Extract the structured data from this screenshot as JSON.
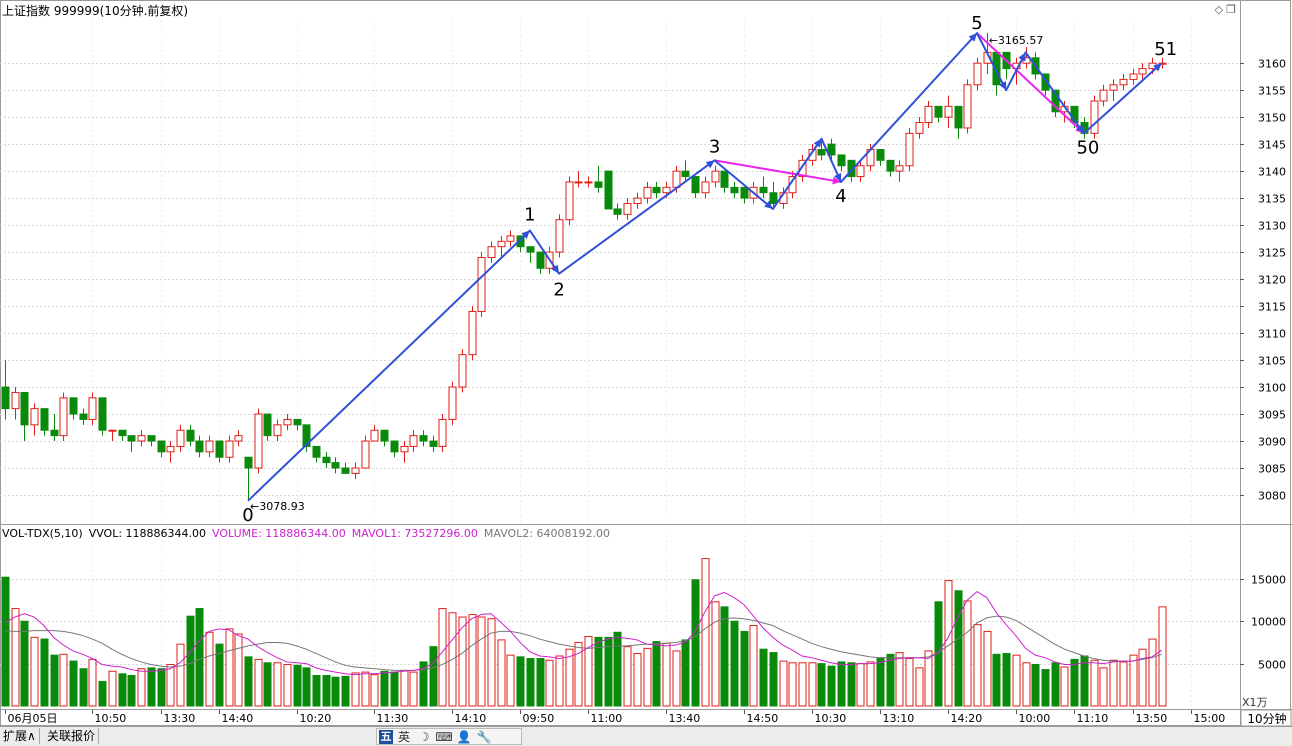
{
  "header": {
    "title": "上证指数 999999(10分钟.前复权)",
    "icons": [
      "diamond-icon",
      "restore-window-icon"
    ]
  },
  "colors": {
    "up": "#e0201a",
    "down": "#0a8a0a",
    "wave": "#3050d8",
    "wave_alt": "#ee22ee",
    "mavol1": "#cc22cc",
    "mavol2": "#777777",
    "grid": "#d8d8d8"
  },
  "chart_data": [
    {
      "type": "candlestick",
      "ylim": [
        3075,
        3168
      ],
      "yticks": [
        3080,
        3085,
        3090,
        3095,
        3100,
        3105,
        3110,
        3115,
        3120,
        3125,
        3130,
        3135,
        3140,
        3145,
        3150,
        3155,
        3160
      ],
      "grid": true,
      "candles": [
        [
          3100,
          3105,
          3094,
          3096
        ],
        [
          3096,
          3100,
          3094,
          3099
        ],
        [
          3099,
          3099,
          3090,
          3093
        ],
        [
          3093,
          3097,
          3091,
          3096
        ],
        [
          3096,
          3096,
          3091,
          3092
        ],
        [
          3092,
          3095,
          3090,
          3091
        ],
        [
          3091,
          3099,
          3090,
          3098
        ],
        [
          3098,
          3098,
          3094,
          3095
        ],
        [
          3095,
          3096,
          3093,
          3094
        ],
        [
          3094,
          3099,
          3093,
          3098
        ],
        [
          3098,
          3098,
          3091,
          3092
        ],
        [
          3092,
          3092,
          3090,
          3092
        ],
        [
          3092,
          3092,
          3090,
          3091
        ],
        [
          3091,
          3091,
          3088,
          3090
        ],
        [
          3090,
          3092,
          3089,
          3091
        ],
        [
          3091,
          3091,
          3089,
          3090
        ],
        [
          3090,
          3090,
          3087,
          3088
        ],
        [
          3088,
          3090,
          3086,
          3089
        ],
        [
          3089,
          3093,
          3088,
          3092
        ],
        [
          3092,
          3093,
          3089,
          3090
        ],
        [
          3090,
          3091,
          3087,
          3088
        ],
        [
          3088,
          3091,
          3087,
          3090
        ],
        [
          3090,
          3090,
          3086,
          3087
        ],
        [
          3087,
          3091,
          3086,
          3090
        ],
        [
          3090,
          3092,
          3089,
          3091
        ],
        [
          3087,
          3087,
          3078.93,
          3085
        ],
        [
          3085,
          3096,
          3084,
          3095
        ],
        [
          3095,
          3095,
          3090,
          3091
        ],
        [
          3091,
          3094,
          3090,
          3093
        ],
        [
          3093,
          3095,
          3092,
          3094
        ],
        [
          3094,
          3094,
          3092,
          3093
        ],
        [
          3093,
          3093,
          3088,
          3089
        ],
        [
          3089,
          3089,
          3086,
          3087
        ],
        [
          3087,
          3088,
          3085,
          3086
        ],
        [
          3086,
          3087,
          3084,
          3085
        ],
        [
          3085,
          3086,
          3084,
          3084
        ],
        [
          3084,
          3086,
          3083,
          3085
        ],
        [
          3085,
          3091,
          3085,
          3090
        ],
        [
          3090,
          3093,
          3090,
          3092
        ],
        [
          3092,
          3092,
          3089,
          3090
        ],
        [
          3090,
          3090,
          3087,
          3088
        ],
        [
          3088,
          3090,
          3086,
          3089
        ],
        [
          3089,
          3092,
          3088,
          3091
        ],
        [
          3091,
          3092,
          3089,
          3090
        ],
        [
          3090,
          3091,
          3088,
          3089
        ],
        [
          3089,
          3095,
          3088,
          3094
        ],
        [
          3094,
          3101,
          3093,
          3100
        ],
        [
          3100,
          3107,
          3099,
          3106
        ],
        [
          3106,
          3115,
          3105,
          3114
        ],
        [
          3114,
          3125,
          3113,
          3124
        ],
        [
          3124,
          3127,
          3123,
          3126
        ],
        [
          3126,
          3128,
          3124,
          3127
        ],
        [
          3127,
          3129,
          3126,
          3128
        ],
        [
          3128,
          3128,
          3125,
          3126
        ],
        [
          3126,
          3126,
          3123,
          3125
        ],
        [
          3125,
          3125,
          3121,
          3122
        ],
        [
          3122,
          3126,
          3121,
          3125
        ],
        [
          3125,
          3132,
          3124,
          3131
        ],
        [
          3131,
          3139,
          3130,
          3138
        ],
        [
          3138,
          3140,
          3137,
          3138
        ],
        [
          3138,
          3139,
          3137,
          3138
        ],
        [
          3138,
          3141,
          3136,
          3137
        ],
        [
          3140,
          3140,
          3133,
          3133
        ],
        [
          3133,
          3134,
          3131,
          3132
        ],
        [
          3132,
          3135,
          3131,
          3134
        ],
        [
          3134,
          3136,
          3133,
          3135
        ],
        [
          3135,
          3138,
          3134,
          3137
        ],
        [
          3137,
          3138,
          3135,
          3136
        ],
        [
          3136,
          3138,
          3135,
          3137
        ],
        [
          3137,
          3141,
          3136,
          3140
        ],
        [
          3140,
          3142,
          3138,
          3139
        ],
        [
          3139,
          3139,
          3135,
          3136
        ],
        [
          3136,
          3139,
          3135,
          3138
        ],
        [
          3138,
          3141,
          3137,
          3140
        ],
        [
          3140,
          3140,
          3136,
          3137
        ],
        [
          3137,
          3138,
          3135,
          3136
        ],
        [
          3137,
          3137,
          3134,
          3135
        ],
        [
          3135,
          3138,
          3134,
          3137
        ],
        [
          3137,
          3139,
          3135,
          3136
        ],
        [
          3136,
          3138,
          3133,
          3134
        ],
        [
          3134,
          3137,
          3133,
          3136
        ],
        [
          3136,
          3140,
          3135,
          3139
        ],
        [
          3139,
          3143,
          3138,
          3142
        ],
        [
          3142,
          3145,
          3141,
          3144
        ],
        [
          3144,
          3146,
          3142,
          3143
        ],
        [
          3145,
          3146,
          3142,
          3143
        ],
        [
          3143,
          3143,
          3140,
          3141
        ],
        [
          3142,
          3142,
          3138,
          3139
        ],
        [
          3139,
          3142,
          3138,
          3141
        ],
        [
          3141,
          3145,
          3140,
          3144
        ],
        [
          3144,
          3144,
          3141,
          3142
        ],
        [
          3142,
          3142,
          3139,
          3140
        ],
        [
          3140,
          3142,
          3138,
          3141
        ],
        [
          3141,
          3148,
          3140,
          3147
        ],
        [
          3147,
          3150,
          3146,
          3149
        ],
        [
          3149,
          3153,
          3148,
          3152
        ],
        [
          3152,
          3152,
          3149,
          3150
        ],
        [
          3150,
          3154,
          3148,
          3152
        ],
        [
          3152,
          3152,
          3146,
          3148
        ],
        [
          3148,
          3157,
          3147,
          3156
        ],
        [
          3156,
          3161,
          3155,
          3160
        ],
        [
          3160,
          3165.57,
          3158,
          3162
        ],
        [
          3162,
          3162,
          3154,
          3156
        ],
        [
          3162,
          3162,
          3157,
          3159
        ],
        [
          3159,
          3161,
          3156,
          3160
        ],
        [
          3160,
          3163,
          3159,
          3161
        ],
        [
          3161,
          3162,
          3157,
          3158
        ],
        [
          3158,
          3158,
          3154,
          3155
        ],
        [
          3155,
          3155,
          3150,
          3151
        ],
        [
          3151,
          3153,
          3149,
          3152
        ],
        [
          3152,
          3152,
          3148,
          3149
        ],
        [
          3149,
          3150,
          3146,
          3147
        ],
        [
          3147,
          3154,
          3146,
          3153
        ],
        [
          3153,
          3156,
          3152,
          3155
        ],
        [
          3155,
          3157,
          3153,
          3156
        ],
        [
          3156,
          3158,
          3155,
          3157
        ],
        [
          3157,
          3159,
          3156,
          3158
        ],
        [
          3158,
          3160,
          3157,
          3159
        ],
        [
          3159,
          3161,
          3158,
          3160
        ],
        [
          3160,
          3161,
          3159,
          3160
        ]
      ],
      "annotations": [
        {
          "text": "3078.93"
        },
        {
          "text": "3165.57"
        }
      ],
      "wave_labels": [
        "0",
        "1",
        "2",
        "3",
        "4",
        "5",
        "50",
        "51"
      ],
      "wave_main": [
        [
          25,
          3078.93
        ],
        [
          54,
          3129
        ],
        [
          57,
          3121
        ],
        [
          73,
          3142
        ],
        [
          79,
          3133
        ],
        [
          84,
          3146
        ],
        [
          86,
          3138
        ],
        [
          100,
          3165.57
        ],
        [
          103,
          3155
        ],
        [
          105,
          3162
        ],
        [
          111,
          3147
        ],
        [
          119,
          3160
        ]
      ],
      "wave_magenta": [
        [
          73,
          3142
        ],
        [
          86,
          3138
        ]
      ],
      "wave_magenta2": [
        [
          100,
          3165.57
        ],
        [
          111,
          3147
        ]
      ]
    },
    {
      "type": "bar",
      "title": "VOL-TDX(5,10)",
      "ylim": [
        0,
        19000
      ],
      "yticks": [
        5000,
        10000,
        15000
      ],
      "unit": "X1万",
      "legend": [
        {
          "label": "VVOL: 118886344.00",
          "color": "#000000"
        },
        {
          "label": "VOLUME: 118886344.00",
          "color": "#cc22cc"
        },
        {
          "label": "MAVOL1: 73527296.00",
          "color": "#cc22cc"
        },
        {
          "label": "MAVOL2: 64008192.00",
          "color": "#777777"
        }
      ],
      "volumes": [
        15200,
        11500,
        10000,
        8100,
        7900,
        6000,
        6100,
        5300,
        4400,
        5500,
        2900,
        4100,
        3800,
        3600,
        4400,
        4500,
        4400,
        4900,
        7300,
        10600,
        11500,
        8700,
        7300,
        9100,
        8500,
        5800,
        5500,
        5100,
        5100,
        4900,
        4800,
        4500,
        3600,
        3600,
        3400,
        3500,
        3900,
        4000,
        3700,
        4100,
        4000,
        4200,
        4000,
        5200,
        7000,
        11500,
        11000,
        10500,
        10800,
        10500,
        10300,
        7800,
        6000,
        5800,
        5600,
        5600,
        5400,
        5900,
        6700,
        7500,
        8200,
        8100,
        8100,
        8700,
        7000,
        6200,
        6800,
        7600,
        7400,
        6500,
        7800,
        14900,
        17400,
        12300,
        11700,
        10000,
        8800,
        9500,
        6700,
        6300,
        5300,
        5100,
        5100,
        5100,
        5000,
        4700,
        5200,
        5100,
        5000,
        5200,
        5700,
        6100,
        6300,
        5600,
        4500,
        6500,
        12300,
        14800,
        13600,
        12400,
        9600,
        8800,
        6100,
        6200,
        6000,
        5100,
        4900,
        4300,
        5100,
        4600,
        5500,
        5900,
        5400,
        4500,
        5400,
        5200,
        6000,
        6700,
        7900,
        11700
      ],
      "mavol1": [
        9800,
        10500,
        10900,
        10500,
        9500,
        8100,
        7200,
        6500,
        6100,
        5600,
        4900,
        4700,
        4600,
        4300,
        4100,
        4100,
        4200,
        4400,
        5100,
        6300,
        7700,
        8800,
        9100,
        9000,
        8300,
        7900,
        7000,
        6300,
        5700,
        5200,
        5100,
        5000,
        4500,
        4200,
        4000,
        3800,
        3700,
        3800,
        3800,
        3900,
        4000,
        4100,
        4200,
        4400,
        5000,
        6400,
        7800,
        9200,
        10300,
        10800,
        10900,
        9900,
        8800,
        7500,
        6400,
        5900,
        5800,
        5600,
        5800,
        6200,
        6900,
        7500,
        7900,
        8100,
        8000,
        7800,
        7300,
        7200,
        7100,
        7200,
        7500,
        8800,
        11100,
        13000,
        13400,
        12800,
        12000,
        10600,
        9200,
        8100,
        7200,
        6600,
        5900,
        5700,
        5400,
        5100,
        4900,
        4900,
        5000,
        5000,
        5100,
        5400,
        5600,
        5700,
        5700,
        5600,
        6300,
        8000,
        10400,
        12500,
        13500,
        12800,
        11000,
        9600,
        8300,
        6800,
        6000,
        5700,
        5200,
        4900,
        4900,
        5100,
        5100,
        5000,
        5200,
        5300,
        5300,
        5600,
        5800,
        6600
      ],
      "mavol2": [
        8900,
        8800,
        8800,
        8900,
        8900,
        8900,
        8800,
        8600,
        8300,
        7900,
        7400,
        6700,
        6100,
        5600,
        5200,
        4900,
        4700,
        4600,
        4700,
        5000,
        5500,
        5900,
        6200,
        6500,
        6800,
        7100,
        7300,
        7500,
        7500,
        7400,
        7100,
        6700,
        6200,
        5700,
        5200,
        4800,
        4600,
        4500,
        4400,
        4300,
        4200,
        4200,
        4200,
        4300,
        4500,
        4900,
        5500,
        6200,
        7100,
        7900,
        8600,
        8800,
        8800,
        8600,
        8300,
        7900,
        7600,
        7300,
        7100,
        6900,
        6800,
        6900,
        7000,
        7100,
        7100,
        7200,
        7300,
        7300,
        7400,
        7500,
        7700,
        8200,
        9100,
        9900,
        10300,
        10400,
        10300,
        10100,
        9800,
        9500,
        8900,
        8400,
        7900,
        7400,
        7000,
        6700,
        6400,
        6200,
        6000,
        5800,
        5700,
        5700,
        5700,
        5700,
        5700,
        5800,
        6300,
        7100,
        7900,
        8700,
        9800,
        10400,
        10600,
        10500,
        10100,
        9400,
        8700,
        8000,
        7300,
        6700,
        6300,
        5900,
        5600,
        5400,
        5300,
        5300,
        5300,
        5500,
        5700,
        6100
      ]
    }
  ],
  "time_axis": {
    "ticks": [
      {
        "i": 0,
        "label": "06月05日"
      },
      {
        "i": 9,
        "label": "10:50"
      },
      {
        "i": 16,
        "label": "13:30"
      },
      {
        "i": 22,
        "label": "14:40"
      },
      {
        "i": 30,
        "label": "10:20"
      },
      {
        "i": 38,
        "label": "11:30"
      },
      {
        "i": 46,
        "label": "14:10"
      },
      {
        "i": 53,
        "label": "09:50"
      },
      {
        "i": 60,
        "label": "11:00"
      },
      {
        "i": 68,
        "label": "13:40"
      },
      {
        "i": 76,
        "label": "14:50"
      },
      {
        "i": 83,
        "label": "10:30"
      },
      {
        "i": 90,
        "label": "13:10"
      },
      {
        "i": 97,
        "label": "14:20"
      },
      {
        "i": 104,
        "label": "10:00"
      },
      {
        "i": 110,
        "label": "11:10"
      },
      {
        "i": 116,
        "label": "13:50"
      },
      {
        "i": 122,
        "label": "15:00"
      }
    ]
  },
  "period_button": "10分钟",
  "bottom": {
    "expand_button": "扩展∧",
    "related_button": "关联报价",
    "ime_items": [
      "五",
      "英",
      "☽",
      "⌨",
      "👤",
      "🔧"
    ]
  }
}
